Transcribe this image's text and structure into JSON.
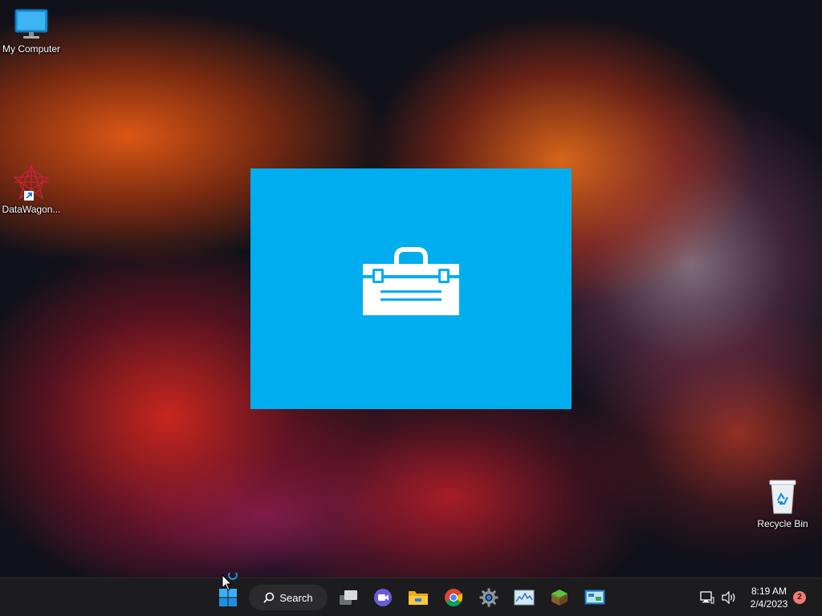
{
  "desktop": {
    "icons": [
      {
        "label": "My Computer",
        "icon": "monitor-icon"
      },
      {
        "label": "DataWagon...",
        "icon": "datawagon-icon"
      },
      {
        "label": "Recycle Bin",
        "icon": "recycle-bin-icon"
      }
    ]
  },
  "splash": {
    "background": "#00adef",
    "icon": "toolbox-icon"
  },
  "taskbar": {
    "search_label": "Search",
    "apps": [
      {
        "name": "start",
        "icon": "windows-start-icon"
      },
      {
        "name": "task-view",
        "icon": "task-view-icon"
      },
      {
        "name": "meet",
        "icon": "video-call-icon"
      },
      {
        "name": "file-explorer",
        "icon": "folder-icon"
      },
      {
        "name": "chrome",
        "icon": "chrome-icon"
      },
      {
        "name": "settings",
        "icon": "gear-icon"
      },
      {
        "name": "monitor",
        "icon": "performance-monitor-icon"
      },
      {
        "name": "minecraft",
        "icon": "grass-block-icon"
      },
      {
        "name": "control-panel",
        "icon": "control-panel-icon"
      }
    ],
    "clock": {
      "time": "8:19 AM",
      "date": "2/4/2023"
    },
    "notification_count": "2"
  },
  "colors": {
    "taskbar": "#1c1c1e",
    "accent": "#00adef",
    "badge": "#f47a73"
  }
}
